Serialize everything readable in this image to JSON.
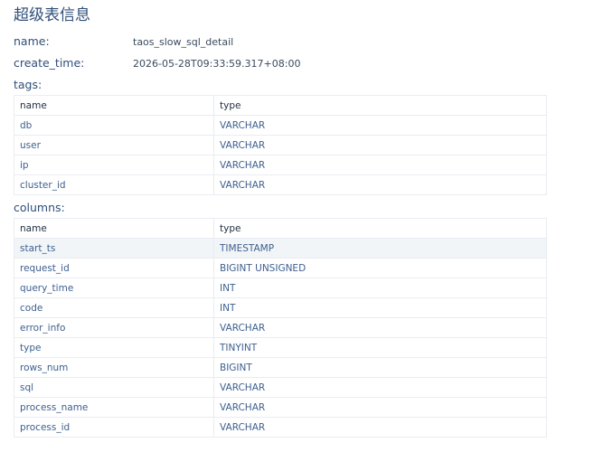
{
  "page": {
    "title": "超级表信息"
  },
  "info": {
    "name_label": "name:",
    "name_value": "taos_slow_sql_detail",
    "create_time_label": "create_time:",
    "create_time_value": "2026-05-28T09:33:59.317+08:00",
    "tags_label": "tags:",
    "columns_label": "columns:"
  },
  "tags_table": {
    "headers": [
      "name",
      "type"
    ],
    "rows": [
      {
        "name": "db",
        "type": "VARCHAR"
      },
      {
        "name": "user",
        "type": "VARCHAR"
      },
      {
        "name": "ip",
        "type": "VARCHAR"
      },
      {
        "name": "cluster_id",
        "type": "VARCHAR"
      }
    ]
  },
  "columns_table": {
    "headers": [
      "name",
      "type"
    ],
    "rows": [
      {
        "name": "start_ts",
        "type": "TIMESTAMP"
      },
      {
        "name": "request_id",
        "type": "BIGINT UNSIGNED"
      },
      {
        "name": "query_time",
        "type": "INT"
      },
      {
        "name": "code",
        "type": "INT"
      },
      {
        "name": "error_info",
        "type": "VARCHAR"
      },
      {
        "name": "type",
        "type": "TINYINT"
      },
      {
        "name": "rows_num",
        "type": "BIGINT"
      },
      {
        "name": "sql",
        "type": "VARCHAR"
      },
      {
        "name": "process_name",
        "type": "VARCHAR"
      },
      {
        "name": "process_id",
        "type": "VARCHAR"
      }
    ]
  }
}
